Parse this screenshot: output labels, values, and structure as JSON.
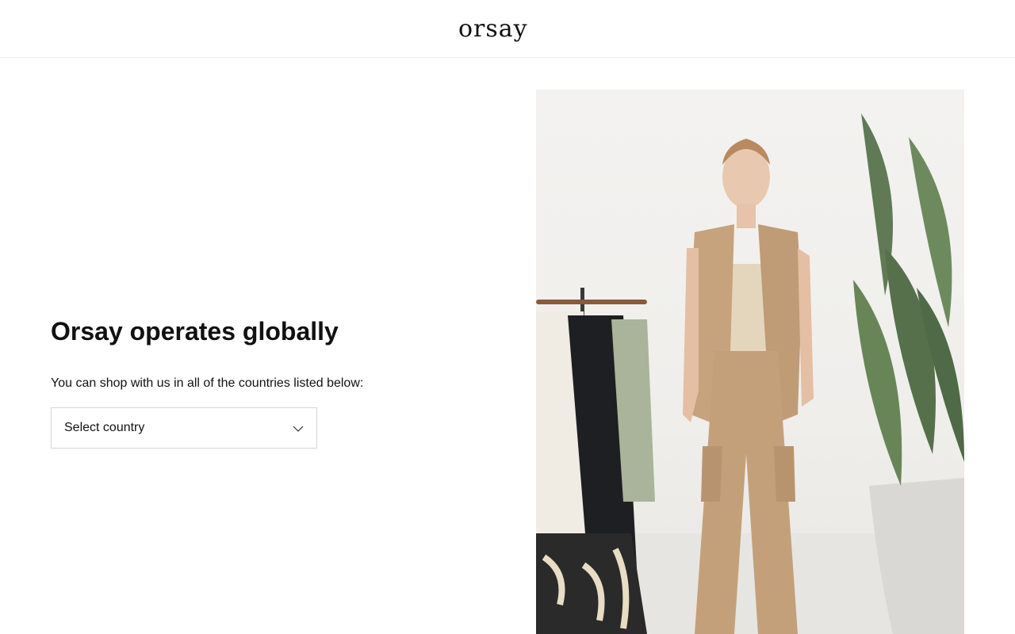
{
  "header": {
    "logo_text": "orsay",
    "logo_icon": "orsay-logo"
  },
  "main": {
    "heading": "Orsay operates globally",
    "subtext": "You can shop with us in all of the countries listed below:",
    "country_select": {
      "placeholder": "Select country",
      "icon": "chevron-down-icon"
    }
  },
  "hero_image": {
    "alt": "Model wearing beige sleeveless blazer and cargo trousers next to a clothing rail and a plant"
  },
  "colors": {
    "text": "#111111",
    "border": "#d6d6d6",
    "background": "#ffffff",
    "divider": "#ececec"
  }
}
